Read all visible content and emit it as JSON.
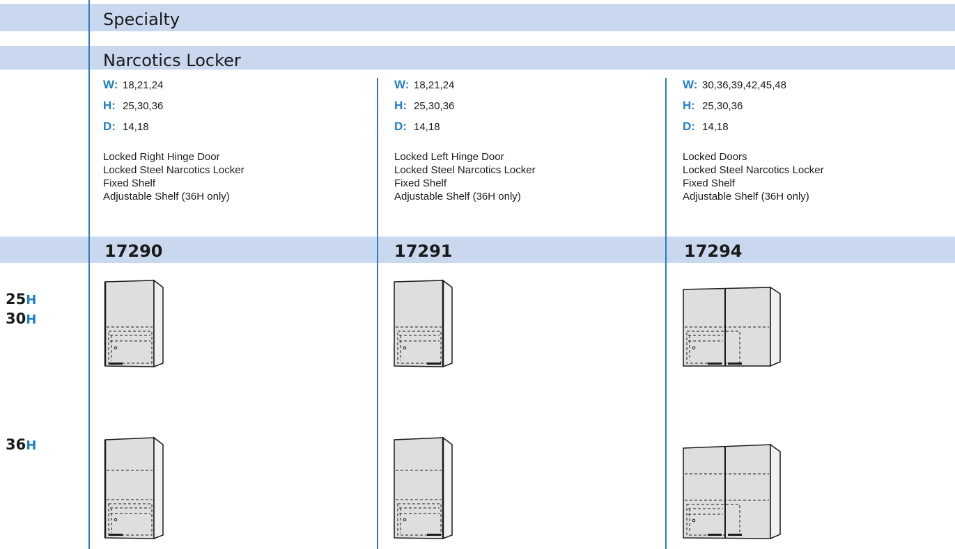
{
  "header": {
    "section": "Specialty",
    "subsection": "Narcotics Locker"
  },
  "columns": [
    {
      "w_label": "W:",
      "w": "18,21,24",
      "h_label": "H:",
      "h": "25,30,36",
      "d_label": "D:",
      "d": "14,18",
      "features": [
        "Locked Right Hinge Door",
        "Locked Steel Narcotics Locker",
        "Fixed Shelf",
        "Adjustable Shelf (36H only)"
      ],
      "model": "17290"
    },
    {
      "w_label": "W:",
      "w": "18,21,24",
      "h_label": "H:",
      "h": "25,30,36",
      "d_label": "D:",
      "d": "14,18",
      "features": [
        "Locked Left Hinge Door",
        "Locked Steel Narcotics Locker",
        "Fixed Shelf",
        "Adjustable Shelf (36H only)"
      ],
      "model": "17291"
    },
    {
      "w_label": "W:",
      "w": "30,36,39,42,45,48",
      "h_label": "H:",
      "h": "25,30,36",
      "d_label": "D:",
      "d": "14,18",
      "features": [
        "Locked Doors",
        "Locked Steel Narcotics Locker",
        "Fixed Shelf",
        "Adjustable Shelf (36H only)"
      ],
      "model": "17294"
    }
  ],
  "heights": {
    "row1": [
      {
        "num": "25",
        "unit": "H"
      },
      {
        "num": "30",
        "unit": "H"
      }
    ],
    "row2": [
      {
        "num": "36",
        "unit": "H"
      }
    ]
  },
  "colors": {
    "accent": "#1f7fc4",
    "band": "#c9d8ee",
    "rule": "#2a7cc4"
  }
}
